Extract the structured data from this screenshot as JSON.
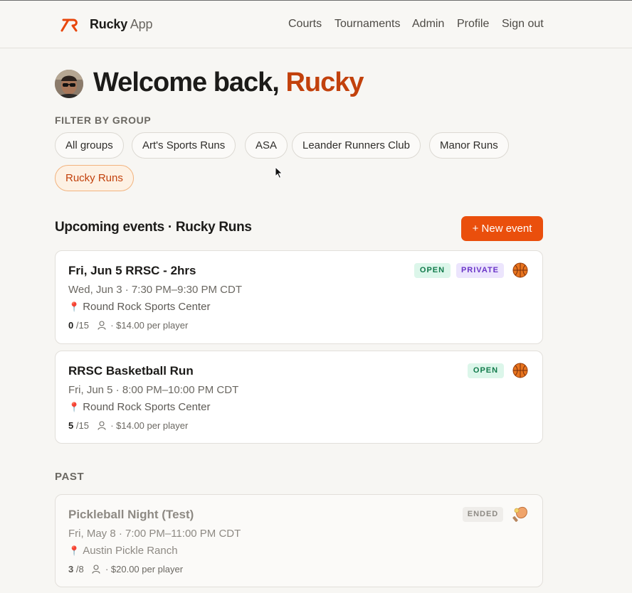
{
  "header": {
    "brand_primary": "Rucky",
    "brand_secondary": "App",
    "nav": [
      {
        "label": "Courts"
      },
      {
        "label": "Tournaments"
      },
      {
        "label": "Admin"
      },
      {
        "label": "Profile"
      },
      {
        "label": "Sign out"
      }
    ]
  },
  "welcome": {
    "prefix": "Welcome back,",
    "name": "Rucky"
  },
  "filter": {
    "label": "FILTER BY GROUP",
    "groups": [
      {
        "label": "All groups",
        "active": false
      },
      {
        "label": "Art's Sports Runs",
        "active": false
      },
      {
        "label": "ASA",
        "active": false
      },
      {
        "label": "Leander Runners Club",
        "active": false
      },
      {
        "label": "Manor Runs",
        "active": false
      },
      {
        "label": "Rucky Runs",
        "active": true
      }
    ]
  },
  "upcoming": {
    "heading": "Upcoming events · Rucky Runs",
    "new_event_label": "+ New event",
    "events": [
      {
        "title": "Fri, Jun 5 RRSC - 2hrs",
        "when": "Wed, Jun 3 · 7:30 PM–9:30 PM CDT",
        "where": "Round Rock Sports Center",
        "count": "0",
        "capacity": "/15",
        "price": "· $14.00 per player",
        "badges": [
          "OPEN",
          "PRIVATE"
        ],
        "sport_icon": "basketball-icon"
      },
      {
        "title": "RRSC Basketball Run",
        "when": "Fri, Jun 5 · 8:00 PM–10:00 PM CDT",
        "where": "Round Rock Sports Center",
        "count": "5",
        "capacity": "/15",
        "price": "· $14.00 per player",
        "badges": [
          "OPEN"
        ],
        "sport_icon": "basketball-icon"
      }
    ]
  },
  "past": {
    "label": "PAST",
    "events": [
      {
        "title": "Pickleball Night (Test)",
        "when": "Fri, May 8 · 7:00 PM–11:00 PM CDT",
        "where": "Austin Pickle Ranch",
        "count": "3",
        "capacity": "/8",
        "price": "· $20.00 per player",
        "badges": [
          "ENDED"
        ],
        "sport_icon": "pickleball-icon"
      }
    ]
  },
  "colors": {
    "accent": "#ea4f0c",
    "accent_text": "#c2410c",
    "open_badge": "#dcf6ea",
    "private_badge": "#ece5fd"
  }
}
